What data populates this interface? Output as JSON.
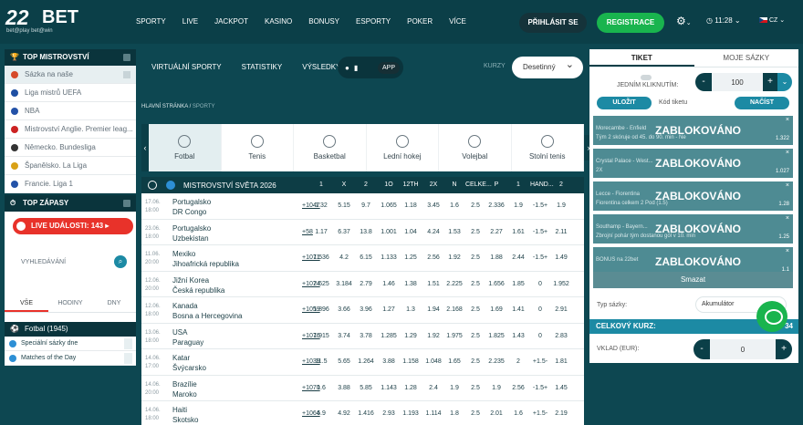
{
  "header": {
    "logo_num": "22",
    "logo_text": "BET",
    "logo_tagline": "bet@play bet@win",
    "nav": [
      "SPORTY",
      "LIVE",
      "JACKPOT",
      "KASINO",
      "BONUSY",
      "ESPORTY",
      "POKER",
      "VÍCE"
    ],
    "login": "PŘIHLÁSIT SE",
    "register": "REGISTRACE",
    "time": "11:28",
    "lang": "CZ"
  },
  "sidebar": {
    "top_title": "TOP MISTROVSTVÍ",
    "top_items": [
      {
        "label": "Sázka na naše",
        "color": "#d64a2a"
      },
      {
        "label": "Liga mistrů UEFA",
        "color": "#1e4fa3"
      },
      {
        "label": "NBA",
        "color": "#2452a8"
      },
      {
        "label": "Mistrovství Anglie. Premier leag...",
        "color": "#cc2222"
      },
      {
        "label": "Německo. Bundesliga",
        "color": "#333333"
      },
      {
        "label": "Španělsko. La Liga",
        "color": "#d9a116"
      },
      {
        "label": "Francie. Liga 1",
        "color": "#2353a8"
      }
    ],
    "zapasy_title": "TOP ZÁPASY",
    "live_label": "LIVE UDÁLOSTI: 143",
    "search_label": "VYHLEDÁVÁNÍ",
    "tabs": [
      "VŠE",
      "HODINY",
      "DNY"
    ],
    "sport": "Fotbal (1945)",
    "subs": [
      "Speciální sázky dne",
      "Matches of the Day"
    ]
  },
  "subnav": {
    "items": [
      "VIRTUÁLNÍ SPORTY",
      "STATISTIKY",
      "VÝSLEDKY"
    ],
    "app": "APP",
    "odds_label": "KURZY",
    "odds_value": "Desetinný"
  },
  "breadcrumb": {
    "home": "HLAVNÍ STRÁNKA",
    "current": "SPORTY"
  },
  "sports": [
    "Fotbal",
    "Tenis",
    "Basketbal",
    "Lední hokej",
    "Volejbal",
    "Stolní tenis"
  ],
  "table": {
    "title": "MISTROVSTVÍ SVĚTA 2026",
    "headers": [
      "1",
      "X",
      "2",
      "1O",
      "12TH",
      "2X",
      "N",
      "CELKE...",
      "P",
      "1",
      "HAND...",
      "2"
    ],
    "rows": [
      {
        "date": "17.06.",
        "time": "18:00",
        "t1": "Portugalsko",
        "t2": "DR Congo",
        "more": "+1047",
        "odds": [
          "1.32",
          "5.15",
          "9.7",
          "1.065",
          "1.18",
          "3.45",
          "1.6",
          "2.5",
          "2.336",
          "1.9",
          "-1.5+",
          "1.9"
        ]
      },
      {
        "date": "23.06.",
        "time": "18:00",
        "t1": "Portugalsko",
        "t2": "Uzbekistan",
        "more": "+58",
        "odds": [
          "1.17",
          "6.37",
          "13.8",
          "1.001",
          "1.04",
          "4.24",
          "1.53",
          "2.5",
          "2.27",
          "1.61",
          "-1.5+",
          "2.11"
        ]
      },
      {
        "date": "11.06.",
        "time": "20:00",
        "t1": "Mexiko",
        "t2": "Jihoafrická republika",
        "more": "+1071",
        "odds": [
          "1.536",
          "4.2",
          "6.15",
          "1.133",
          "1.25",
          "2.56",
          "1.92",
          "2.5",
          "1.88",
          "2.44",
          "-1.5+",
          "1.49"
        ]
      },
      {
        "date": "12.06.",
        "time": "20:00",
        "t1": "Jižní Korea",
        "t2": "Česká republika",
        "more": "+1074",
        "odds": [
          "2.625",
          "3.184",
          "2.79",
          "1.46",
          "1.38",
          "1.51",
          "2.225",
          "2.5",
          "1.656",
          "1.85",
          "0",
          "1.952"
        ]
      },
      {
        "date": "12.06.",
        "time": "18:00",
        "t1": "Kanada",
        "t2": "Bosna a Hercegovina",
        "more": "+1059",
        "odds": [
          "1.896",
          "3.66",
          "3.96",
          "1.27",
          "1.3",
          "1.94",
          "2.168",
          "2.5",
          "1.69",
          "1.41",
          "0",
          "2.91"
        ]
      },
      {
        "date": "13.06.",
        "time": "18:00",
        "t1": "USA",
        "t2": "Paraguay",
        "more": "+1076",
        "odds": [
          "1.915",
          "3.74",
          "3.78",
          "1.285",
          "1.29",
          "1.92",
          "1.975",
          "2.5",
          "1.825",
          "1.43",
          "0",
          "2.83"
        ]
      },
      {
        "date": "14.06.",
        "time": "17:00",
        "t1": "Katar",
        "t2": "Švýcarsko",
        "more": "+1039",
        "odds": [
          "11.5",
          "5.65",
          "1.264",
          "3.88",
          "1.158",
          "1.048",
          "1.65",
          "2.5",
          "2.235",
          "2",
          "+1.5-",
          "1.81"
        ]
      },
      {
        "date": "14.06.",
        "time": "20:00",
        "t1": "Brazílie",
        "t2": "Maroko",
        "more": "+1070",
        "odds": [
          "1.6",
          "3.88",
          "5.85",
          "1.143",
          "1.28",
          "2.4",
          "1.9",
          "2.5",
          "1.9",
          "2.56",
          "-1.5+",
          "1.45"
        ]
      },
      {
        "date": "14.06.",
        "time": "18:00",
        "t1": "Haiti",
        "t2": "Skotsko",
        "more": "+1064",
        "odds": [
          "6.9",
          "4.92",
          "1.416",
          "2.93",
          "1.193",
          "1.114",
          "1.8",
          "2.5",
          "2.01",
          "1.6",
          "+1.5-",
          "2.19"
        ]
      }
    ]
  },
  "ticket": {
    "tab1": "TIKET",
    "tab2": "MOJE SÁZKY",
    "oneclick": "JEDNÍM KLIKNUTÍM:",
    "stake": "100",
    "save": "ULOŽIT",
    "code": "Kód tiketu",
    "load": "NAČÍST",
    "blocked": [
      {
        "l1": "...",
        "l2": "Morecambe - Enfield",
        "l3": "Tým 2 skóruje od 45. do 90. min - Ne",
        "odd": "1.322"
      },
      {
        "l1": "...",
        "l2": "Crystal Palace - West...",
        "l3": "2X",
        "odd": "1.027"
      },
      {
        "l1": "...",
        "l2": "Lecce - Fiorentina",
        "l3": "Fiorentina celkem 2 Pod (1.5)",
        "odd": "1.28"
      },
      {
        "l1": "...",
        "l2": "Southamp - Bayern...",
        "l3": "Zbrojní pohár tým dostanou gól v 10. min",
        "odd": "1.25"
      },
      {
        "l1": "...",
        "l2": "BONUS na 22bet",
        "l3": "",
        "odd": "1.1"
      }
    ],
    "blocked_label": "ZABLOKOVÁNO",
    "delete": "Smazat",
    "bet_type_label": "Typ sázky:",
    "bet_type": "Akumulátor",
    "total_label": "CELKOVÝ KURZ:",
    "total_value": "34",
    "stake_label": "VKLAD (EUR):",
    "stake_value": "0"
  }
}
